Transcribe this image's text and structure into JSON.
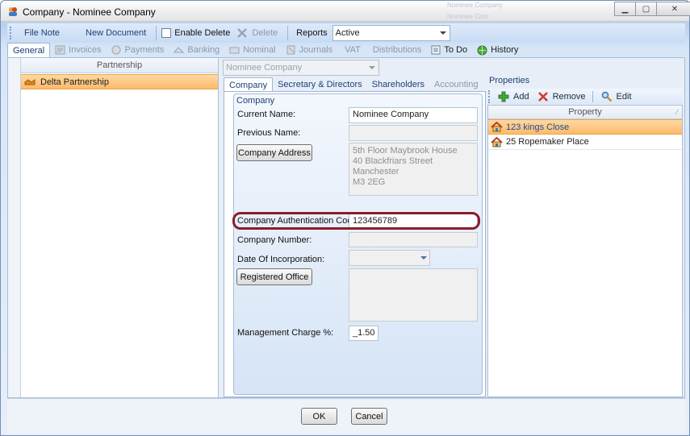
{
  "window": {
    "title": "Company - Nominee Company",
    "ghost_text_1": "Nominee Company",
    "ghost_text_2": "Nominee Com"
  },
  "toolbar": {
    "file_note": "File Note",
    "new_document": "New Document",
    "enable_delete": "Enable Delete",
    "delete": "Delete",
    "reports": "Reports",
    "status_value": "Active"
  },
  "nav_tabs": {
    "general": "General",
    "invoices": "Invoices",
    "payments": "Payments",
    "banking": "Banking",
    "nominal": "Nominal",
    "journals": "Journals",
    "vat": "VAT",
    "distributions": "Distributions",
    "todo": "To Do",
    "history": "History"
  },
  "partnership": {
    "header": "Partnership",
    "items": [
      "Delta Partnership"
    ]
  },
  "company_select": "Nominee Company",
  "sub_tabs": {
    "company": "Company",
    "secretary": "Secretary & Directors",
    "shareholders": "Shareholders",
    "accounting": "Accounting"
  },
  "company_form": {
    "group_title": "Company",
    "current_name_label": "Current Name:",
    "current_name_value": "Nominee Company",
    "previous_name_label": "Previous Name:",
    "previous_name_value": "",
    "company_address_button": "Company Address",
    "address_lines": [
      "5th Floor Maybrook House",
      "40 Blackfriars Street",
      "Manchester",
      "M3 2EG"
    ],
    "auth_code_label": "Company Authentication Code:",
    "auth_code_value": "123456789",
    "company_number_label": "Company Number:",
    "company_number_value": "",
    "date_incorporation_label": "Date Of Incorporation:",
    "registered_office_button": "Registered Office",
    "management_charge_label": "Management Charge %:",
    "management_charge_value": "_1.50"
  },
  "properties": {
    "title": "Properties",
    "add": "Add",
    "remove": "Remove",
    "edit": "Edit",
    "column": "Property",
    "items": [
      "123 kings Close",
      "25 Ropemaker Place"
    ]
  },
  "footer": {
    "ok": "OK",
    "cancel": "Cancel"
  },
  "colors": {
    "selection_orange": "#fdb96a",
    "highlight_ring": "#8c1c2a",
    "link_blue": "#1f3f77"
  }
}
